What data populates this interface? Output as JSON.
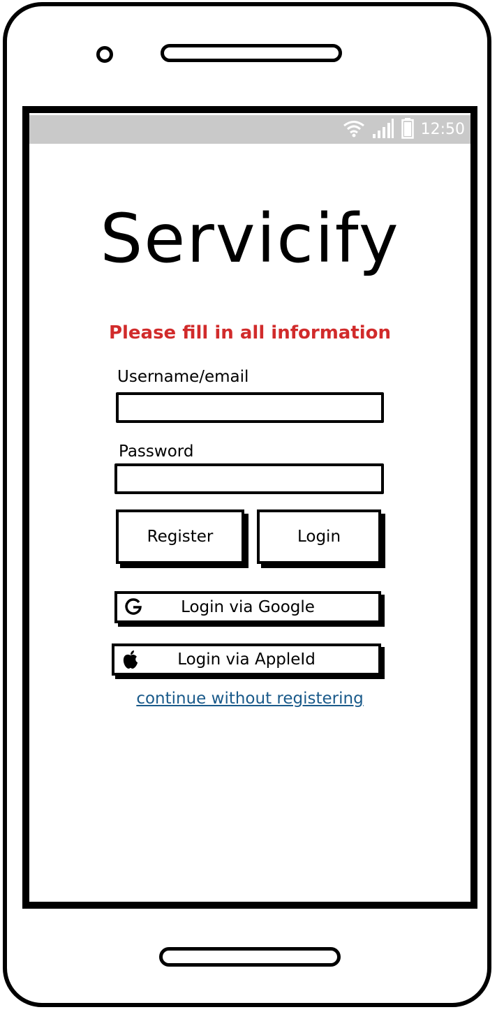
{
  "status_bar": {
    "time": "12:50",
    "icons": [
      "wifi-icon",
      "signal-icon",
      "battery-icon"
    ]
  },
  "app": {
    "title": "Servicify"
  },
  "form": {
    "error_message": "Please fill in all information",
    "username_label": "Username/email",
    "username_value": "",
    "password_label": "Password",
    "password_value": "",
    "register_label": "Register",
    "login_label": "Login",
    "google_label": "Login via Google",
    "apple_label": "Login via AppleId",
    "guest_link": "continue without registering"
  },
  "colors": {
    "error": "#d12b2b",
    "link": "#1a5a8a",
    "status_bar": "#c9c9c9"
  }
}
